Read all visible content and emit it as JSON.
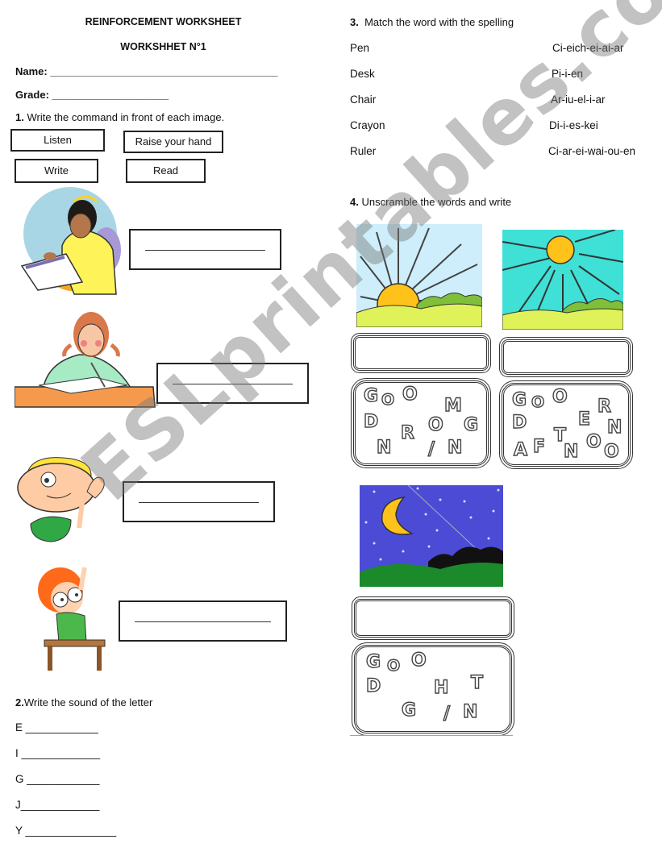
{
  "header": {
    "title": "REINFORCEMENT WORKSHEET",
    "subtitle": "WORKSHHET N°1",
    "name_label": "Name:",
    "name_line": "_______________________________________",
    "grade_label": "Grade:",
    "grade_line": "____________________"
  },
  "section1": {
    "number": "1.",
    "instruction": "Write the command in front of each image.",
    "commands": [
      "Listen",
      "Raise your hand",
      "Write",
      "Read"
    ],
    "images": [
      "girl-reading",
      "girl-writing",
      "boy-listening",
      "boy-raising-hand"
    ]
  },
  "section2": {
    "number": "2.",
    "instruction": "Write the sound of the letter",
    "letters": [
      {
        "letter": "E",
        "line": "____________"
      },
      {
        "letter": "I",
        "line": "_____________"
      },
      {
        "letter": "G",
        "line": "____________"
      },
      {
        "letter": "J",
        "line": "_____________"
      },
      {
        "letter": "Y",
        "line": "_______________"
      }
    ]
  },
  "section3": {
    "number": "3.",
    "instruction": "Match the word with the spelling",
    "words": [
      "Pen",
      "Desk",
      "Chair",
      "Crayon",
      "Ruler"
    ],
    "spellings": [
      "Ci-eich-ei-ai-ar",
      "Pi-i-en",
      "Ar-iu-el-i-ar",
      "Di-i-es-kei",
      "Ci-ar-ei-wai-ou-en"
    ]
  },
  "section4": {
    "number": "4.",
    "instruction": "Unscramble the words and write",
    "puzzles": [
      {
        "scene": "sunrise",
        "letters": [
          "G",
          "O",
          "O",
          "M",
          "D",
          "R",
          "O",
          "G",
          "N",
          "/",
          "N"
        ]
      },
      {
        "scene": "afternoon-sun",
        "letters": [
          "G",
          "O",
          "O",
          "R",
          "D",
          "E",
          "N",
          "T",
          "A",
          "F",
          "N",
          "O",
          "O"
        ]
      },
      {
        "scene": "night-moon",
        "letters": [
          "G",
          "O",
          "O",
          "D",
          "H",
          "T",
          "G",
          "/",
          "N"
        ]
      }
    ]
  },
  "watermark": "ESLprintables.com"
}
